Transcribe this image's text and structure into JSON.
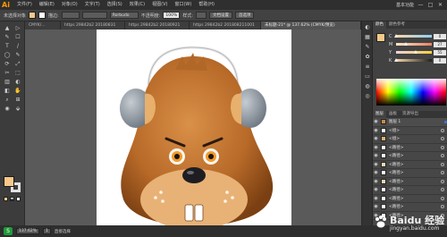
{
  "app": {
    "logo": "Ai",
    "workspace": "基本功能"
  },
  "menu": [
    "文件(F)",
    "编辑(E)",
    "对象(O)",
    "文字(T)",
    "选择(S)",
    "效果(C)",
    "视图(V)",
    "窗口(W)",
    "帮助(H)"
  ],
  "window_controls": [
    "—",
    "□",
    "✕"
  ],
  "control_bar": {
    "selection_label": "未选择对象",
    "stroke_label": "描边:",
    "brush": "Rorbudo",
    "opacity_label": "不透明度:",
    "opacity_value": "100%",
    "style_label": "样式:",
    "doc_setup": "文档设置",
    "prefs": "首选项"
  },
  "tabs": [
    {
      "label": "CMYK/...",
      "active": false
    },
    {
      "label": "https 29842b2 20180831",
      "active": false
    },
    {
      "label": "https 29842b2 20180921",
      "active": false
    },
    {
      "label": "https 29842b2 201808211001",
      "active": false
    },
    {
      "label": "未标题-21* @ 137.62% (CMYK/预览)",
      "active": true
    }
  ],
  "tools": [
    "▲",
    "▷",
    "✎",
    "☐",
    "T",
    "/",
    "◯",
    "✎",
    "⟳",
    "⤢",
    "✂",
    "⬚",
    "▥",
    "◐",
    "◧",
    "✋",
    "⌕",
    "⊞",
    "◉",
    "⬙"
  ],
  "colors": {
    "fill": "#f6c98a",
    "stroke": "#e2e2e2",
    "canvas": "#5a5a5a",
    "face": "#b86a28",
    "face_light": "#e8a860",
    "muzzle": "#f0c08a",
    "earmuff": "#9aa4ae",
    "accent": "#ff9a00"
  },
  "color_panel": {
    "tabs": [
      "颜色",
      "颜色参考"
    ],
    "sliders": [
      {
        "letter": "C",
        "value": "0",
        "position": 0.0,
        "gradient": "linear-gradient(to right, #f8d8a8, #8fd0f0)"
      },
      {
        "letter": "M",
        "value": "27",
        "position": 0.27,
        "gradient": "linear-gradient(to right, #f8e8c8, #e88060)"
      },
      {
        "letter": "Y",
        "value": "55",
        "position": 0.55,
        "gradient": "linear-gradient(to right, #f0d0e0, #f8d040)"
      },
      {
        "letter": "K",
        "value": "0",
        "position": 0.0,
        "gradient": "linear-gradient(to right, #f8d8a8, #202020)"
      }
    ]
  },
  "layers_panel": {
    "tabs": [
      "图层",
      "画板",
      "资源导出"
    ],
    "rows": [
      {
        "name": "图层 1",
        "selected": true
      },
      {
        "name": "<组>",
        "selected": false
      },
      {
        "name": "<组>",
        "selected": false
      },
      {
        "name": "<路径>",
        "selected": false
      },
      {
        "name": "<路径>",
        "selected": false
      },
      {
        "name": "<路径>",
        "selected": false
      },
      {
        "name": "<路径>",
        "selected": false
      },
      {
        "name": "<路径>",
        "selected": false
      },
      {
        "name": "<路径>",
        "selected": false
      },
      {
        "name": "<路径>",
        "selected": false
      },
      {
        "name": "<路径>",
        "selected": false
      },
      {
        "name": "<路径>",
        "selected": false
      }
    ]
  },
  "status_bar": {
    "zoom": "137.62%",
    "artboard": "1",
    "tool": "直接选择"
  },
  "watermark": {
    "title": "Baidu 经验",
    "url": "jingyan.baidu.com"
  }
}
